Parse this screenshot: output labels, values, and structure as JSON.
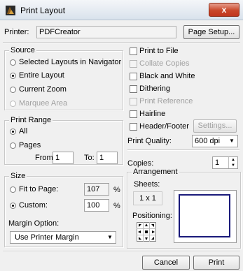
{
  "window": {
    "title": "Print Layout",
    "close_glyph": "x"
  },
  "printer": {
    "label": "Printer:",
    "value": "PDFCreator",
    "setup_button": "Page Setup..."
  },
  "source": {
    "title": "Source",
    "options": [
      {
        "label": "Selected Layouts in Navigator",
        "selected": false,
        "enabled": true
      },
      {
        "label": "Entire Layout",
        "selected": true,
        "enabled": true
      },
      {
        "label": "Current Zoom",
        "selected": false,
        "enabled": true
      },
      {
        "label": "Marquee Area",
        "selected": false,
        "enabled": false
      }
    ]
  },
  "print_range": {
    "title": "Print Range",
    "all_label": "All",
    "pages_label": "Pages",
    "from_label": "From:",
    "from_value": "1",
    "to_label": "To:",
    "to_value": "1"
  },
  "options": {
    "print_to_file": "Print to File",
    "collate_copies": "Collate Copies",
    "black_and_white": "Black and White",
    "dithering": "Dithering",
    "print_reference": "Print Reference",
    "hairline": "Hairline",
    "header_footer": "Header/Footer",
    "settings_button": "Settings...",
    "quality_label": "Print Quality:",
    "quality_value": "600 dpi"
  },
  "size": {
    "title": "Size",
    "fit_label": "Fit to Page:",
    "fit_value": "107",
    "custom_label": "Custom:",
    "custom_value": "100",
    "percent": "%"
  },
  "margin": {
    "label": "Margin Option:",
    "value": "Use Printer Margin"
  },
  "copies": {
    "label": "Copies:",
    "value": "1"
  },
  "arrangement": {
    "title": "Arrangement",
    "sheets_label": "Sheets:",
    "sheets_value": "1 x 1",
    "positioning_label": "Positioning:"
  },
  "footer": {
    "cancel": "Cancel",
    "print": "Print"
  }
}
